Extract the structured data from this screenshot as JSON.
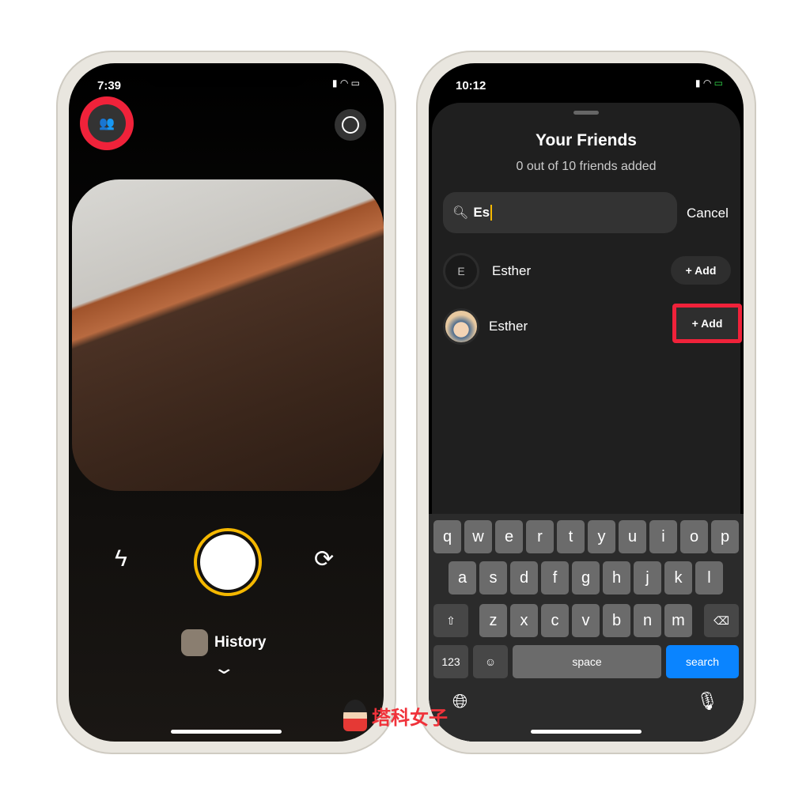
{
  "left": {
    "time": "7:39",
    "history_label": "History",
    "icons": [
      "friends-icon",
      "profile-icon",
      "flash-icon",
      "flip-camera-icon",
      "chevron-down-icon"
    ],
    "shutter_ring_color": "#f5b800",
    "highlight_color": "#f0223a"
  },
  "right": {
    "time": "10:12",
    "title": "Your Friends",
    "subtitle": "0 out of 10 friends added",
    "search_value": "Es",
    "cancel_label": "Cancel",
    "results": [
      {
        "initial": "E",
        "name": "Esther",
        "add_label": "+ Add"
      },
      {
        "initial": "",
        "name": "Esther",
        "add_label": "+ Add"
      }
    ],
    "keyboard": {
      "row1": [
        "q",
        "w",
        "e",
        "r",
        "t",
        "y",
        "u",
        "i",
        "o",
        "p"
      ],
      "row2": [
        "a",
        "s",
        "d",
        "f",
        "g",
        "h",
        "j",
        "k",
        "l"
      ],
      "row3": [
        "z",
        "x",
        "c",
        "v",
        "b",
        "n",
        "m"
      ],
      "numbers": "123",
      "space": "space",
      "search": "search"
    },
    "search_key_color": "#0a84ff"
  },
  "watermark": "塔科女子"
}
